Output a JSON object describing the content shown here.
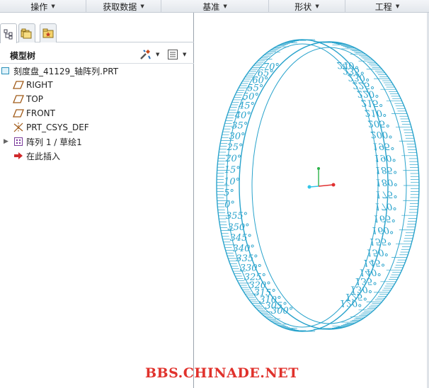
{
  "ribbon": {
    "groups": [
      {
        "label": "操作"
      },
      {
        "label": "获取数据"
      },
      {
        "label": "基准"
      },
      {
        "label": "形状"
      },
      {
        "label": "工程"
      }
    ]
  },
  "model_tree": {
    "title": "模型树",
    "items": [
      {
        "label": "刻度盘_41129_轴阵列.PRT",
        "icon": "part-icon"
      },
      {
        "label": "RIGHT",
        "icon": "datum-plane-icon"
      },
      {
        "label": "TOP",
        "icon": "datum-plane-icon"
      },
      {
        "label": "FRONT",
        "icon": "datum-plane-icon"
      },
      {
        "label": "PRT_CSYS_DEF",
        "icon": "csys-icon"
      },
      {
        "label": "阵列 1 / 草绘1",
        "icon": "pattern-icon"
      },
      {
        "label": "在此插入",
        "icon": "insert-arrow-icon"
      }
    ]
  },
  "dial": {
    "color": "#29a3cc",
    "left_degrees": [
      "300°",
      "305°",
      "310°",
      "315°",
      "320°",
      "325°",
      "330°",
      "335°",
      "340°",
      "345°",
      "350°",
      "355°",
      "0°",
      "5°",
      "10°",
      "15°",
      "20°",
      "25°",
      "30°",
      "35°",
      "40°",
      "45°",
      "50°",
      "55°",
      "60°",
      "65°",
      "70°"
    ],
    "right_degrees": [
      "240°",
      "235°",
      "230°",
      "225°",
      "220°",
      "215°",
      "210°",
      "205°",
      "200°",
      "195°",
      "190°",
      "185°",
      "180°",
      "175°",
      "170°",
      "165°",
      "160°",
      "155°",
      "150°",
      "145°",
      "140°",
      "135°",
      "130°",
      "125°",
      "120°"
    ]
  },
  "colors": {
    "ribbon_bg": "#e8ebef",
    "dial": "#29a3cc",
    "axis_y": "#2db34a",
    "axis_x": "#e03030",
    "axis_z": "#33c6e8",
    "watermark": "#e0322c"
  },
  "watermark": "BBS.CHINADE.NET"
}
